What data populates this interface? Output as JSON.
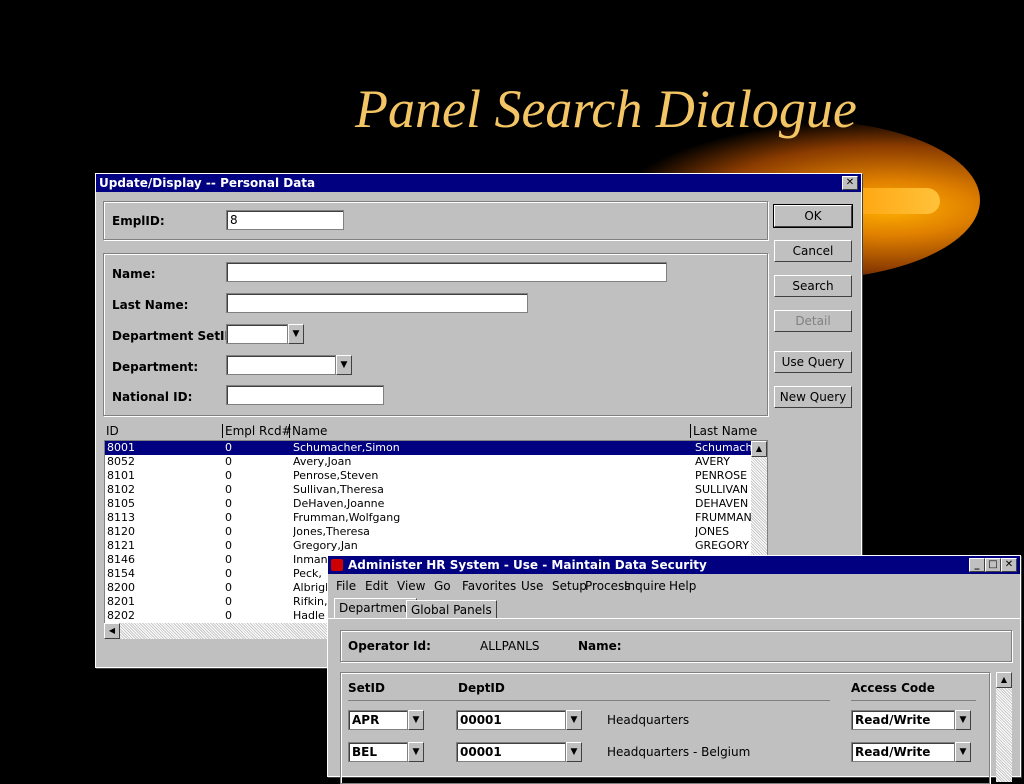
{
  "slide": {
    "title": "Panel Search Dialogue"
  },
  "dialog": {
    "title": "Update/Display -- Personal Data",
    "close_glyph": "✕",
    "emplid_label": "EmplID:",
    "emplid_value": "8",
    "name_label": "Name:",
    "lastname_label": "Last Name:",
    "dept_setid_label": "Department SetID:",
    "department_label": "Department:",
    "national_id_label": "National ID:",
    "buttons": {
      "ok": "OK",
      "cancel": "Cancel",
      "search": "Search",
      "detail": "Detail",
      "use_query": "Use Query",
      "new_query": "New Query"
    },
    "results": {
      "headers": [
        "ID",
        "Empl Rcd#",
        "Name",
        "Last Name"
      ],
      "rows": [
        [
          "8001",
          "0",
          "Schumacher,Simon",
          "Schumacher"
        ],
        [
          "8052",
          "0",
          "Avery,Joan",
          "AVERY"
        ],
        [
          "8101",
          "0",
          "Penrose,Steven",
          "PENROSE"
        ],
        [
          "8102",
          "0",
          "Sullivan,Theresa",
          "SULLIVAN"
        ],
        [
          "8105",
          "0",
          "DeHaven,Joanne",
          "DEHAVEN"
        ],
        [
          "8113",
          "0",
          "Frumman,Wolfgang",
          "FRUMMAN"
        ],
        [
          "8120",
          "0",
          "Jones,Theresa",
          "JONES"
        ],
        [
          "8121",
          "0",
          "Gregory,Jan",
          "GREGORY"
        ],
        [
          "8146",
          "0",
          "Inman",
          ""
        ],
        [
          "8154",
          "0",
          "Peck,",
          ""
        ],
        [
          "8200",
          "0",
          "Albrigh",
          ""
        ],
        [
          "8201",
          "0",
          "Rifkin,",
          ""
        ],
        [
          "8202",
          "0",
          "Hadle",
          ""
        ]
      ],
      "selected_index": 0
    }
  },
  "hr_window": {
    "title": "Administer HR System - Use - Maintain Data Security",
    "menu": [
      "File",
      "Edit",
      "View",
      "Go",
      "Favorites",
      "Use",
      "Setup",
      "Process",
      "Inquire",
      "Help"
    ],
    "tabs": [
      "Department",
      "Global Panels"
    ],
    "operator_label": "Operator Id:",
    "operator_value": "ALLPANLS",
    "name_label": "Name:",
    "grid_headers": {
      "setid": "SetID",
      "deptid": "DeptID",
      "access": "Access Code"
    },
    "rows": [
      {
        "setid": "APR",
        "deptid": "00001",
        "desc": "Headquarters",
        "access": "Read/Write"
      },
      {
        "setid": "BEL",
        "deptid": "00001",
        "desc": "Headquarters - Belgium",
        "access": "Read/Write"
      }
    ]
  }
}
